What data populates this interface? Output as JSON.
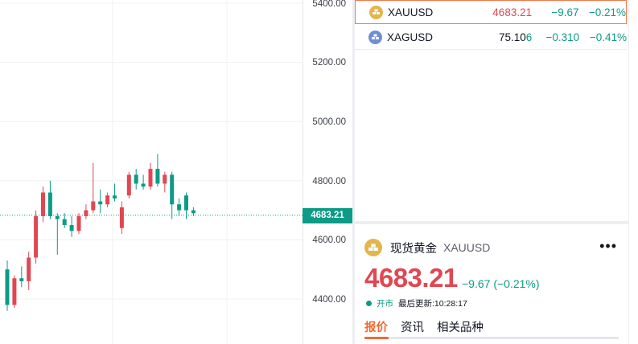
{
  "chart": {
    "price_axis_labels": [
      "5400.00",
      "5200.00",
      "5000.00",
      "4800.00",
      "4600.00",
      "4400.00"
    ],
    "current_price_label": "4683.21",
    "colors": {
      "up": "#e04752",
      "down": "#0c9b86"
    },
    "candles": [
      {
        "o": 4500,
        "h": 4530,
        "l": 4360,
        "c": 4380
      },
      {
        "o": 4380,
        "h": 4480,
        "l": 4370,
        "c": 4470
      },
      {
        "o": 4470,
        "h": 4510,
        "l": 4440,
        "c": 4460
      },
      {
        "o": 4460,
        "h": 4560,
        "l": 4430,
        "c": 4540
      },
      {
        "o": 4540,
        "h": 4700,
        "l": 4520,
        "c": 4680
      },
      {
        "o": 4680,
        "h": 4780,
        "l": 4660,
        "c": 4760
      },
      {
        "o": 4760,
        "h": 4800,
        "l": 4670,
        "c": 4680
      },
      {
        "o": 4680,
        "h": 4690,
        "l": 4550,
        "c": 4670
      },
      {
        "o": 4670,
        "h": 4690,
        "l": 4640,
        "c": 4650
      },
      {
        "o": 4650,
        "h": 4680,
        "l": 4610,
        "c": 4630
      },
      {
        "o": 4630,
        "h": 4690,
        "l": 4620,
        "c": 4680
      },
      {
        "o": 4680,
        "h": 4720,
        "l": 4670,
        "c": 4700
      },
      {
        "o": 4700,
        "h": 4860,
        "l": 4690,
        "c": 4730
      },
      {
        "o": 4730,
        "h": 4770,
        "l": 4690,
        "c": 4720
      },
      {
        "o": 4720,
        "h": 4760,
        "l": 4710,
        "c": 4750
      },
      {
        "o": 4750,
        "h": 4790,
        "l": 4730,
        "c": 4740
      },
      {
        "o": 4640,
        "h": 4730,
        "l": 4620,
        "c": 4710
      },
      {
        "o": 4750,
        "h": 4830,
        "l": 4740,
        "c": 4820
      },
      {
        "o": 4820,
        "h": 4840,
        "l": 4770,
        "c": 4790
      },
      {
        "o": 4790,
        "h": 4820,
        "l": 4770,
        "c": 4780
      },
      {
        "o": 4780,
        "h": 4860,
        "l": 4770,
        "c": 4840
      },
      {
        "o": 4840,
        "h": 4890,
        "l": 4780,
        "c": 4790
      },
      {
        "o": 4790,
        "h": 4830,
        "l": 4760,
        "c": 4820
      },
      {
        "o": 4820,
        "h": 4830,
        "l": 4670,
        "c": 4720
      },
      {
        "o": 4720,
        "h": 4740,
        "l": 4680,
        "c": 4700
      },
      {
        "o": 4750,
        "h": 4760,
        "l": 4670,
        "c": 4700
      },
      {
        "o": 4700,
        "h": 4710,
        "l": 4680,
        "c": 4690
      }
    ]
  },
  "watchlist": [
    {
      "symbol": "XAUUSD",
      "last": "4683.21",
      "last_tail": "",
      "change": "−9.67",
      "change_pct": "−0.21%",
      "icon": "gold-bars-icon"
    },
    {
      "symbol": "XAGUSD",
      "last": "75.10",
      "last_tail": "6",
      "change": "−0.310",
      "change_pct": "−0.41%",
      "icon": "silver-bars-icon"
    }
  ],
  "details": {
    "name": "现货黄金",
    "symbol": "XAUUSD",
    "price": "4683.21",
    "change": "−9.67 (−0.21%)",
    "status_open": "开市",
    "status_updated": "最后更新:10:28:17",
    "tabs": [
      "报价",
      "资讯",
      "相关品种"
    ],
    "more": "•••"
  }
}
